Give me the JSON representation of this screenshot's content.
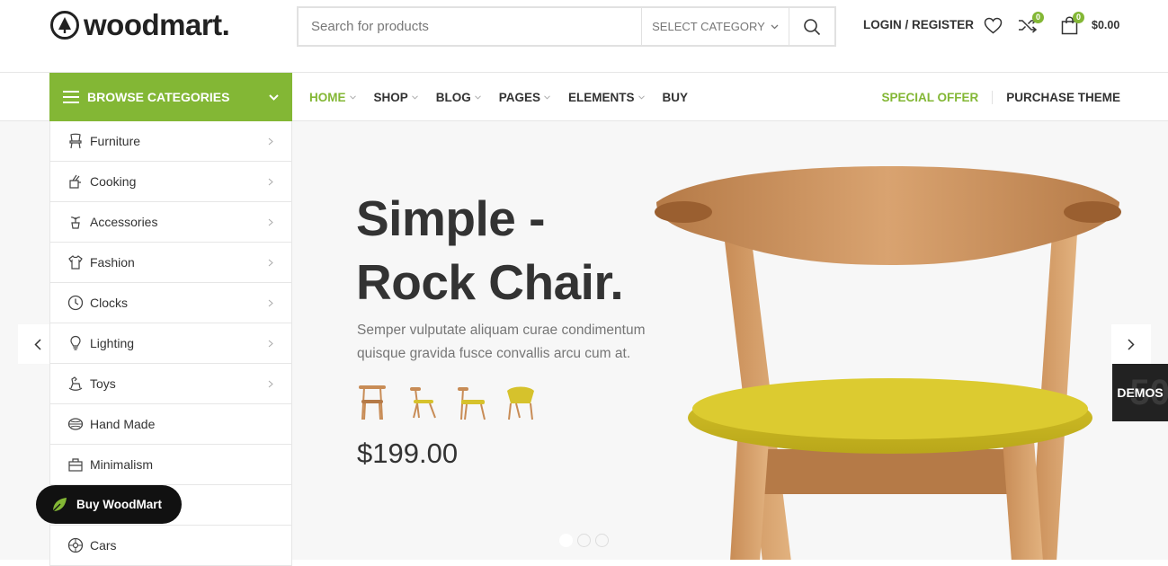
{
  "brand": {
    "name": "woodmart.",
    "accent_color": "#83b735"
  },
  "search": {
    "placeholder": "Search for products",
    "category_label": "SELECT CATEGORY"
  },
  "header": {
    "login_label": "LOGIN / REGISTER",
    "compare_count": "0",
    "cart_count": "0",
    "cart_total": "$0.00"
  },
  "browse": {
    "label": "BROWSE CATEGORIES"
  },
  "nav": {
    "items": [
      {
        "label": "HOME",
        "active": true,
        "dropdown": true
      },
      {
        "label": "SHOP",
        "dropdown": true
      },
      {
        "label": "BLOG",
        "dropdown": true
      },
      {
        "label": "PAGES",
        "dropdown": true
      },
      {
        "label": "ELEMENTS",
        "dropdown": true
      },
      {
        "label": "BUY",
        "dropdown": false
      }
    ],
    "special_offer": "SPECIAL OFFER",
    "purchase_theme": "PURCHASE THEME"
  },
  "categories": [
    {
      "label": "Furniture",
      "icon": "chair-icon",
      "has_sub": true
    },
    {
      "label": "Cooking",
      "icon": "cooking-icon",
      "has_sub": true
    },
    {
      "label": "Accessories",
      "icon": "plant-icon",
      "has_sub": true
    },
    {
      "label": "Fashion",
      "icon": "shirt-icon",
      "has_sub": true
    },
    {
      "label": "Clocks",
      "icon": "clock-icon",
      "has_sub": true
    },
    {
      "label": "Lighting",
      "icon": "bulb-icon",
      "has_sub": true
    },
    {
      "label": "Toys",
      "icon": "rocking-horse-icon",
      "has_sub": true
    },
    {
      "label": "Hand Made",
      "icon": "yarn-icon",
      "has_sub": false
    },
    {
      "label": "Minimalism",
      "icon": "bag-icon",
      "has_sub": false
    },
    {
      "label": "",
      "icon": "",
      "has_sub": false
    },
    {
      "label": "Cars",
      "icon": "wheel-icon",
      "has_sub": false
    }
  ],
  "hero": {
    "title_line1": "Simple -",
    "title_line2": "Rock Chair.",
    "description": "Semper vulputate aliquam curae condimentum quisque gravida fusce convallis arcu cum at.",
    "price": "$199.00",
    "slide_count": 3,
    "active_slide": 1
  },
  "demos": {
    "label": "DEMOS",
    "count": "50"
  },
  "buy_badge": {
    "label": "Buy WoodMart"
  }
}
